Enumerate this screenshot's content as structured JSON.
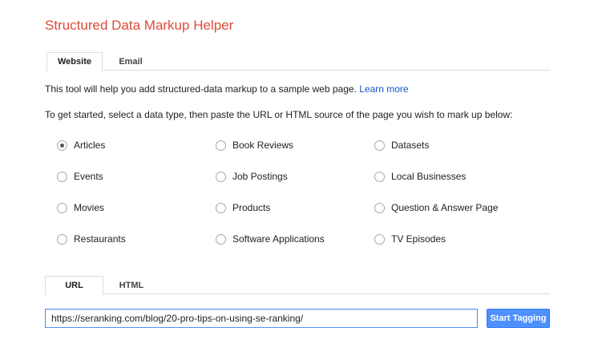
{
  "title": "Structured Data Markup Helper",
  "source_tabs": [
    {
      "label": "Website",
      "active": true
    },
    {
      "label": "Email",
      "active": false
    }
  ],
  "intro": {
    "text": "This tool will help you add structured-data markup to a sample web page.",
    "link": "Learn more"
  },
  "instruction": "To get started, select a data type, then paste the URL or HTML source of the page you wish to mark up below:",
  "data_types": [
    {
      "label": "Articles",
      "checked": true
    },
    {
      "label": "Book Reviews",
      "checked": false
    },
    {
      "label": "Datasets",
      "checked": false
    },
    {
      "label": "Events",
      "checked": false
    },
    {
      "label": "Job Postings",
      "checked": false
    },
    {
      "label": "Local Businesses",
      "checked": false
    },
    {
      "label": "Movies",
      "checked": false
    },
    {
      "label": "Products",
      "checked": false
    },
    {
      "label": "Question & Answer Page",
      "checked": false
    },
    {
      "label": "Restaurants",
      "checked": false
    },
    {
      "label": "Software Applications",
      "checked": false
    },
    {
      "label": "TV Episodes",
      "checked": false
    }
  ],
  "input_tabs": [
    {
      "label": "URL",
      "active": true
    },
    {
      "label": "HTML",
      "active": false
    }
  ],
  "url_input": {
    "value": "https://seranking.com/blog/20-pro-tips-on-using-se-ranking/"
  },
  "start_button": "Start Tagging",
  "colors": {
    "title": "#dd4b39",
    "link": "#1155cc",
    "button": "#4d90fe"
  }
}
